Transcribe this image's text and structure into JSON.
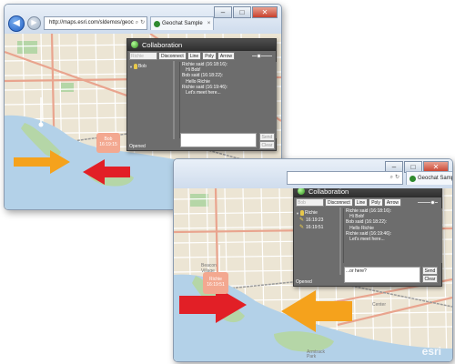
{
  "colors": {
    "water": "#b3d1e8",
    "land": "#ece5d4",
    "park": "#b5d6a7",
    "major_road": "#e9a48e",
    "road": "#ffffff",
    "arrow_orange": "#f5a21c",
    "arrow_red": "#e21f26",
    "marker": "#f3a890",
    "panel_bg": "#6d6d6d"
  },
  "windows": [
    {
      "address": "http://maps.esri.com/sldemos/geoc",
      "tab_title": "Geochat Sample",
      "panel": {
        "title": "Collaboration",
        "username_placeholder": "Richie",
        "buttons": [
          "Disconnect",
          "Line",
          "Poly",
          "Arrow"
        ],
        "users": [
          {
            "name": "Bob"
          }
        ],
        "chat": "Richie said (16:18:16):\n   Hi Bob!\nBob said (16:18:22):\n   Hello Richie\nRichie said (16:19:46):\n   Let's meet here...",
        "message": "",
        "send": "Send",
        "clear": "Clear",
        "status": "Opened"
      },
      "marker": {
        "name": "Bob",
        "time": "16:19:15"
      }
    },
    {
      "tab_title": "Geochat Sample",
      "panel": {
        "title": "Collaboration",
        "username_placeholder": "Bob",
        "buttons": [
          "Disconnect",
          "Line",
          "Poly",
          "Arrow"
        ],
        "users": [
          {
            "name": "Richie"
          },
          {
            "name": "16:19:23"
          },
          {
            "name": "16:19:51"
          }
        ],
        "chat": "Richie said (16:18:16):\n   Hi Bob!\nBob said (16:18:22):\n   Hello Richie\nRichie said (16:19:46):\n   Let's meet here...",
        "message": "...or here?",
        "send": "Send",
        "clear": "Clear",
        "status": "Opened"
      },
      "marker": {
        "name": "Richie",
        "time": "16:19:51"
      },
      "map_labels": {
        "beacon": "Beacon\nVillage",
        "center": "Center",
        "park": "Armtrack\nPark"
      }
    }
  ],
  "esri_logo": "esri"
}
